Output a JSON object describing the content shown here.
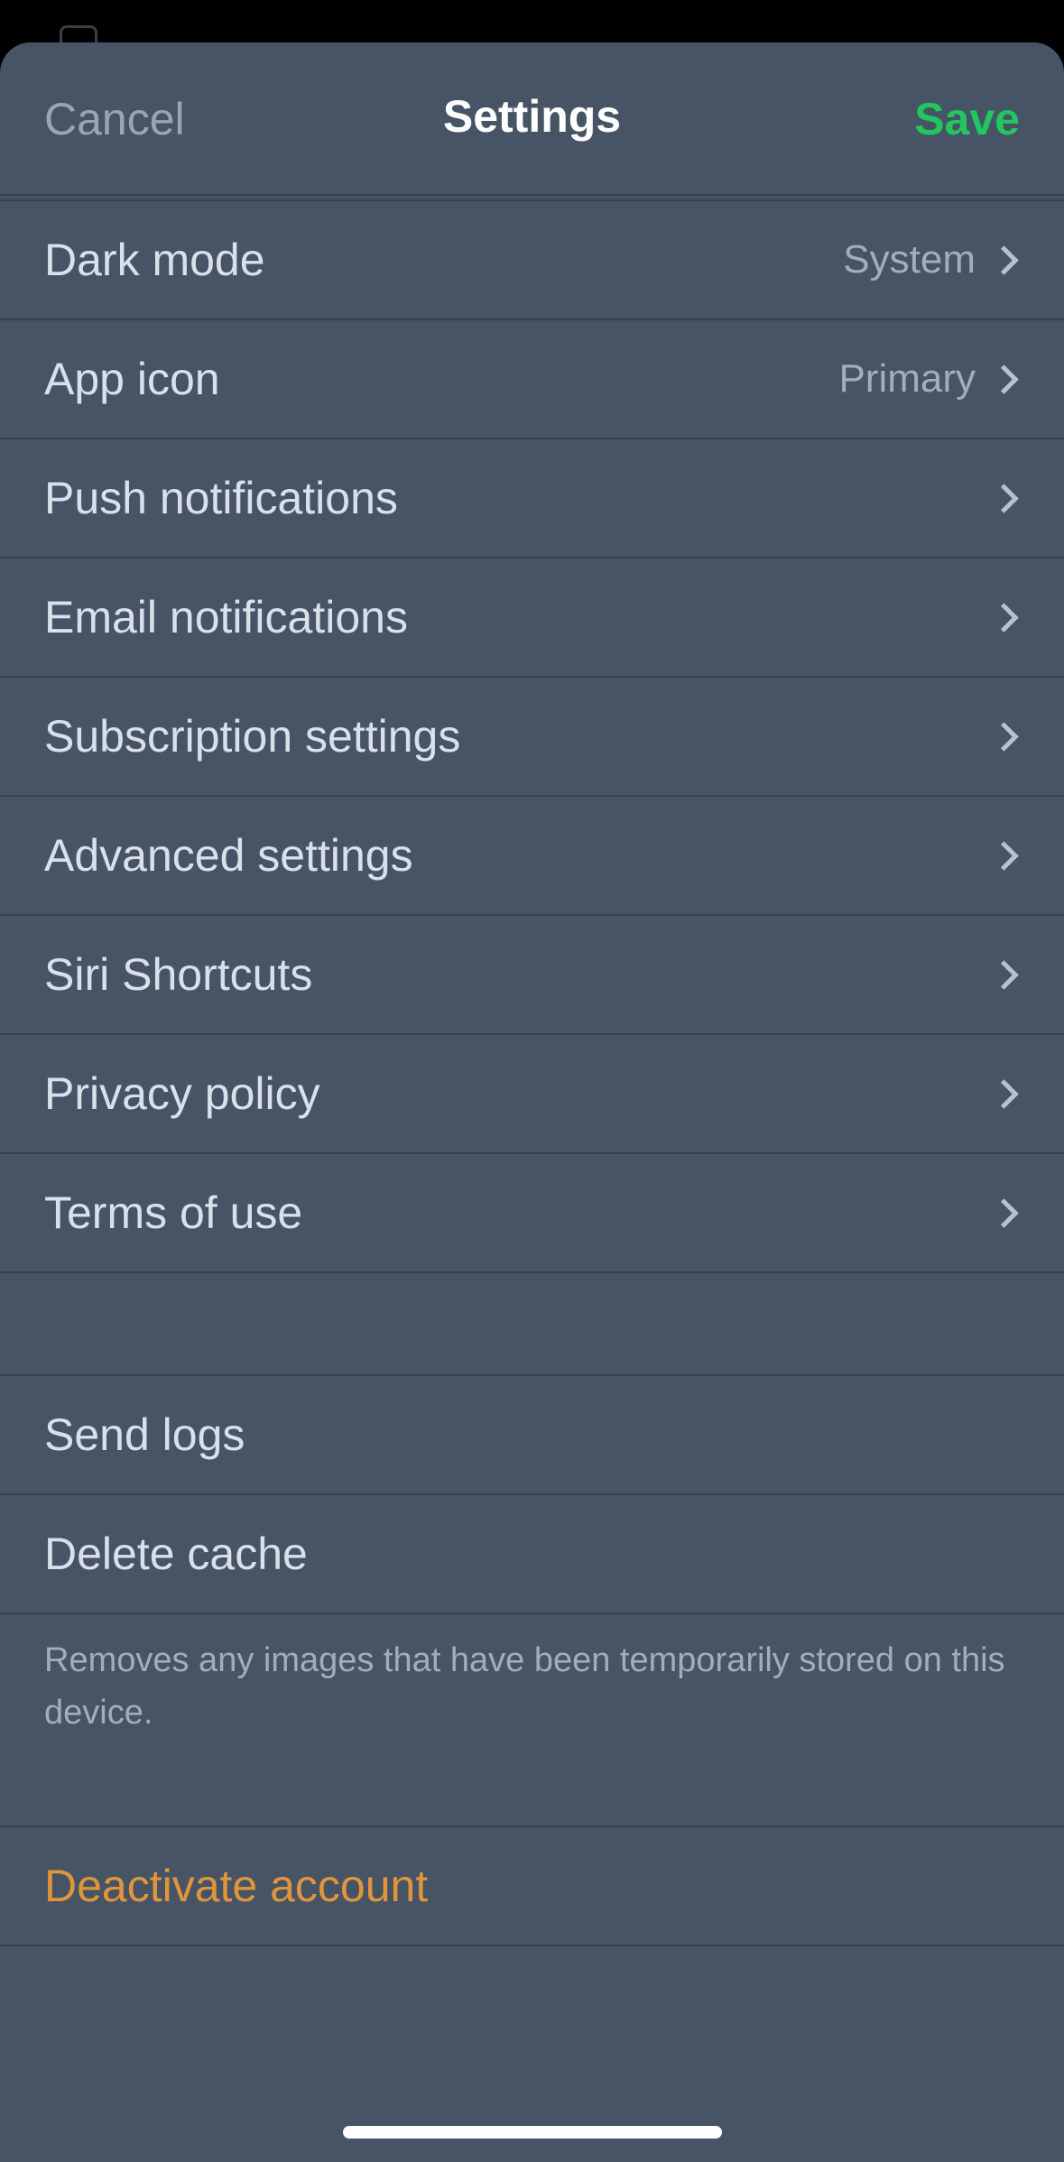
{
  "nav": {
    "cancel_label": "Cancel",
    "title": "Settings",
    "save_label": "Save"
  },
  "settings_group": [
    {
      "label": "Dark mode",
      "value": "System"
    },
    {
      "label": "App icon",
      "value": "Primary"
    },
    {
      "label": "Push notifications",
      "value": ""
    },
    {
      "label": "Email notifications",
      "value": ""
    },
    {
      "label": "Subscription settings",
      "value": ""
    },
    {
      "label": "Advanced settings",
      "value": ""
    },
    {
      "label": "Siri Shortcuts",
      "value": ""
    },
    {
      "label": "Privacy policy",
      "value": ""
    },
    {
      "label": "Terms of use",
      "value": ""
    }
  ],
  "maintenance": {
    "send_logs_label": "Send logs",
    "delete_cache_label": "Delete cache",
    "delete_cache_note": "Removes any images that have been temporarily stored on this device."
  },
  "danger": {
    "deactivate_label": "Deactivate account"
  },
  "colors": {
    "background": "#465466",
    "accent_save": "#22c55e",
    "danger": "#e0953a",
    "divider": "#37424f"
  },
  "icons": {
    "row_chevron": "chevron-right-icon"
  }
}
